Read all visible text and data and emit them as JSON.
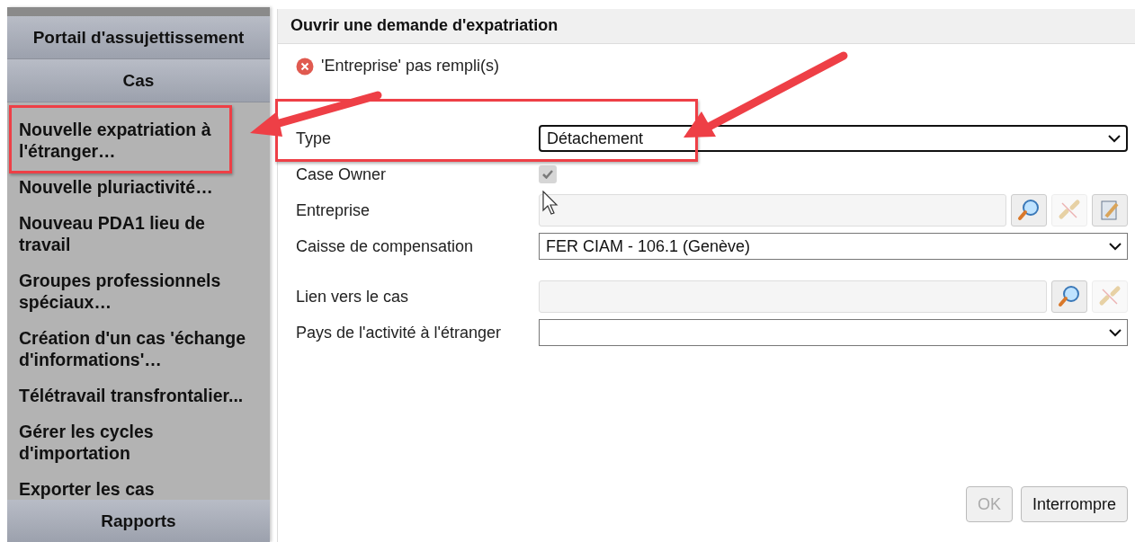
{
  "sidebar": {
    "sections": [
      {
        "title": "Portail d'assujettissement"
      },
      {
        "title": "Cas",
        "items": [
          {
            "label": "Nouvelle expatriation à l'étranger…"
          },
          {
            "label": "Nouvelle pluriactivité…"
          },
          {
            "label": "Nouveau PDA1 lieu de travail"
          },
          {
            "label": "Groupes professionnels spéciaux…"
          },
          {
            "label": "Création d'un cas 'échange d'informations'…"
          },
          {
            "label": "Télétravail transfrontalier..."
          },
          {
            "label": "Gérer les cycles d'importation"
          },
          {
            "label": "Exporter les cas"
          }
        ]
      },
      {
        "title": "Rapports"
      }
    ]
  },
  "dialog": {
    "title": "Ouvrir une demande d'expatriation",
    "error": "'Entreprise' pas rempli(s)",
    "fields": [
      {
        "kind": "select",
        "label": "Type",
        "value": "Détachement",
        "focused": true
      },
      {
        "kind": "checkbox",
        "label": "Case Owner",
        "checked": true,
        "disabled": true
      },
      {
        "kind": "lookup",
        "label": "Entreprise",
        "buttons": [
          {
            "kind": "search",
            "disabled": false
          },
          {
            "kind": "unlink",
            "disabled": true
          },
          {
            "kind": "edit",
            "disabled": false
          }
        ]
      },
      {
        "kind": "select",
        "label": "Caisse de compensation",
        "value": "FER CIAM - 106.1 (Genève)",
        "focused": false
      },
      {
        "kind": "lookup",
        "label": "Lien vers le cas",
        "buttons": [
          {
            "kind": "search",
            "disabled": false
          },
          {
            "kind": "unlink",
            "disabled": true
          }
        ]
      },
      {
        "kind": "select",
        "label": "Pays de l'activité à l'étranger",
        "focused": false
      }
    ],
    "buttons": [
      {
        "label": "OK",
        "disabled": true
      },
      {
        "label": "Interrompre",
        "disabled": false
      }
    ]
  }
}
